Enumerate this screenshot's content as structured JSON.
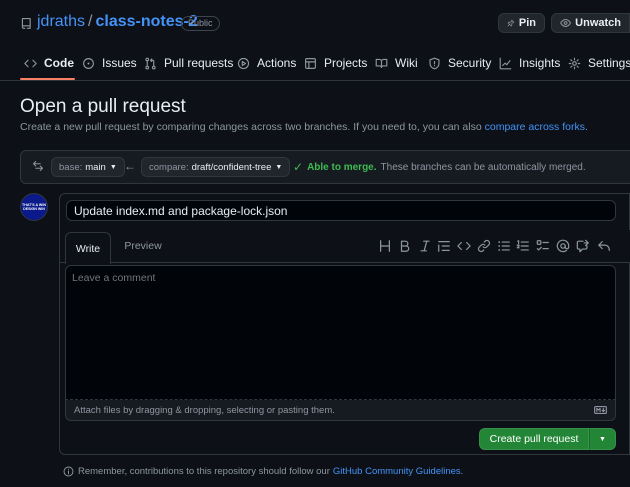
{
  "repo": {
    "owner": "jdraths",
    "separator": "/",
    "name": "class-notes-2",
    "visibility": "Public"
  },
  "header_actions": {
    "pin": "Pin",
    "unwatch": "Unwatch"
  },
  "tabs": [
    {
      "label": "Code",
      "icon": "code-icon",
      "active": true
    },
    {
      "label": "Issues",
      "icon": "issue-icon"
    },
    {
      "label": "Pull requests",
      "icon": "pull-request-icon"
    },
    {
      "label": "Actions",
      "icon": "play-icon"
    },
    {
      "label": "Projects",
      "icon": "table-icon"
    },
    {
      "label": "Wiki",
      "icon": "book-icon"
    },
    {
      "label": "Security",
      "icon": "shield-icon"
    },
    {
      "label": "Insights",
      "icon": "graph-icon"
    },
    {
      "label": "Settings",
      "icon": "gear-icon"
    }
  ],
  "page": {
    "title": "Open a pull request",
    "subtitle": "Create a new pull request by comparing changes across two branches. If you need to, you can also",
    "subtitle_link": "compare across forks",
    "subtitle_end": "."
  },
  "compare": {
    "base_label": "base:",
    "base_value": "main",
    "compare_label": "compare:",
    "compare_value": "draft/confident-tree",
    "merge_status": "Able to merge.",
    "merge_detail": "These branches can be automatically merged."
  },
  "form": {
    "title_value": "Update index.md and package-lock.json",
    "tab_write": "Write",
    "tab_preview": "Preview",
    "comment_placeholder": "Leave a comment",
    "attach_hint": "Attach files by dragging & dropping, selecting or pasting them.",
    "submit_label": "Create pull request"
  },
  "toolbar_icons": [
    "heading-icon",
    "bold-icon",
    "italic-icon",
    "quote-icon",
    "code-icon",
    "link-icon",
    "bulleted-list-icon",
    "numbered-list-icon",
    "task-list-icon",
    "mention-icon",
    "cross-reference-icon",
    "reply-icon"
  ],
  "avatar_text": "THAT'S A WIN\nDESIGN WIN",
  "footer": {
    "note": "Remember, contributions to this repository should follow our",
    "link": "GitHub Community Guidelines",
    "end": "."
  },
  "colors": {
    "accent_tab": "#f78166",
    "success": "#3fb950",
    "button_green": "#238636",
    "link": "#4493f8"
  }
}
